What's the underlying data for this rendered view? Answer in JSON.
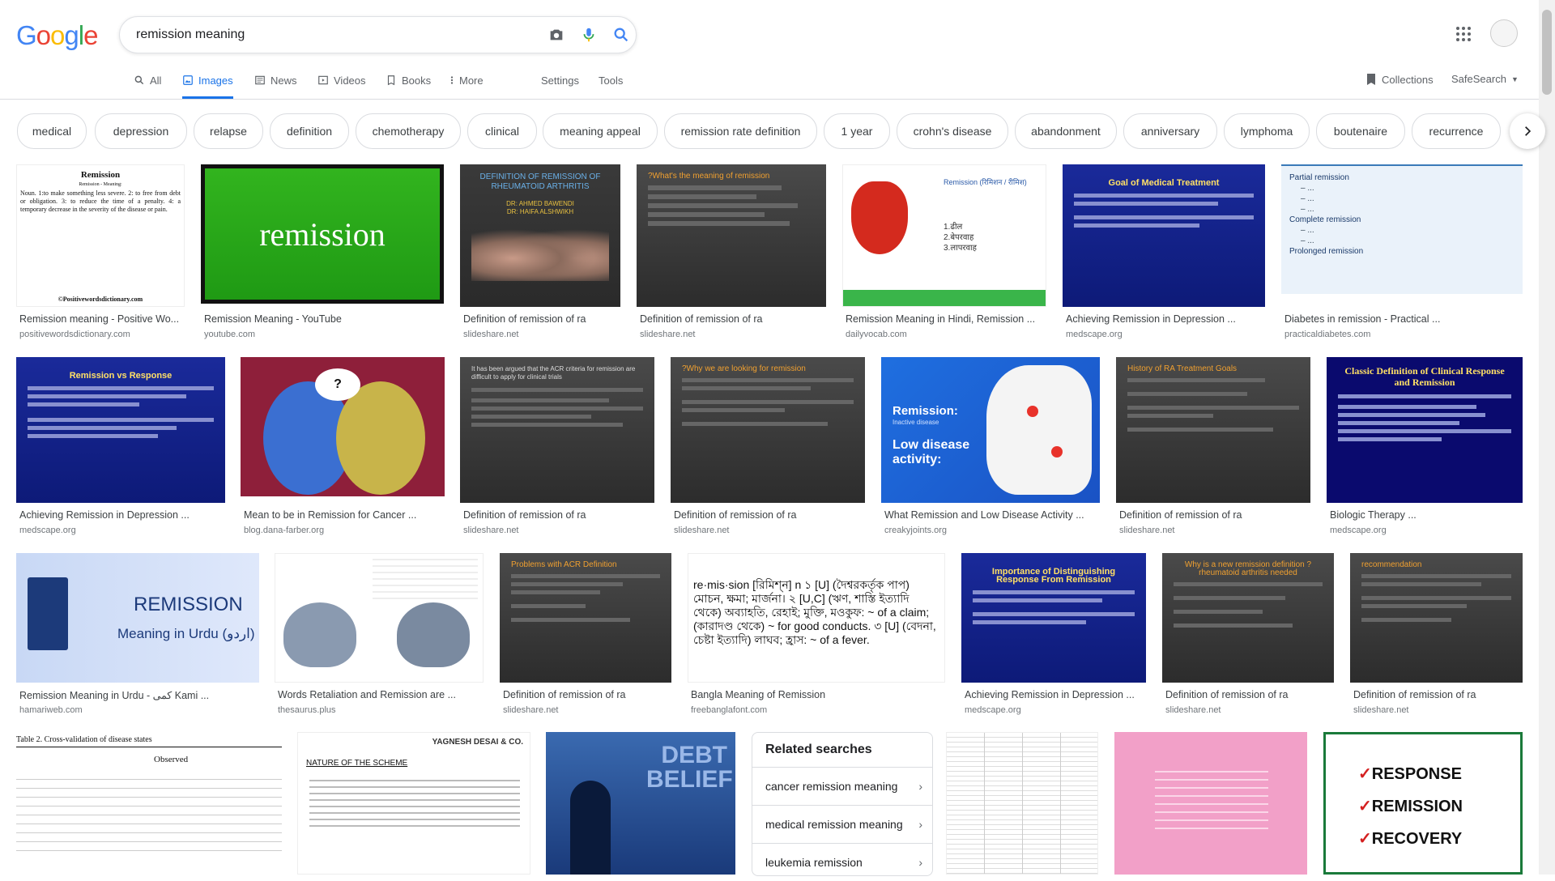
{
  "search": {
    "query": "remission meaning"
  },
  "logo": {
    "letters": [
      "G",
      "o",
      "o",
      "g",
      "l",
      "e"
    ],
    "colors": [
      "#4285f4",
      "#ea4335",
      "#fbbc05",
      "#4285f4",
      "#34a853",
      "#ea4335"
    ]
  },
  "tabs": [
    {
      "label": "All",
      "icon": "search-icon"
    },
    {
      "label": "Images",
      "icon": "image-icon",
      "active": true
    },
    {
      "label": "News",
      "icon": "news-icon"
    },
    {
      "label": "Videos",
      "icon": "video-icon"
    },
    {
      "label": "Books",
      "icon": "book-icon"
    },
    {
      "label": "More",
      "icon": "more-vert-icon"
    }
  ],
  "tools": {
    "settings": "Settings",
    "tools": "Tools",
    "collections": "Collections",
    "safesearch": "SafeSearch"
  },
  "chips": [
    "medical",
    "depression",
    "relapse",
    "definition",
    "chemotherapy",
    "clinical",
    "meaning appeal",
    "remission rate definition",
    "1 year",
    "crohn's disease",
    "abandonment",
    "anniversary",
    "lymphoma",
    "boutenaire",
    "recurrence"
  ],
  "results": [
    {
      "caption": "Remission meaning - Positive Wo...",
      "source": "positivewordsdictionary.com"
    },
    {
      "caption": "Remission Meaning - YouTube",
      "source": "youtube.com"
    },
    {
      "caption": "Definition of remission of ra",
      "source": "slideshare.net"
    },
    {
      "caption": "Definition of remission of ra",
      "source": "slideshare.net"
    },
    {
      "caption": "Remission Meaning in Hindi, Remission ...",
      "source": "dailyvocab.com"
    },
    {
      "caption": "Achieving Remission in Depression ...",
      "source": "medscape.org"
    },
    {
      "caption": "Diabetes in remission - Practical ...",
      "source": "practicaldiabetes.com"
    },
    {
      "caption": "Achieving Remission in Depression ...",
      "source": "medscape.org"
    },
    {
      "caption": "Mean to be in Remission for Cancer ...",
      "source": "blog.dana-farber.org"
    },
    {
      "caption": "Definition of remission of ra",
      "source": "slideshare.net"
    },
    {
      "caption": "Definition of remission of ra",
      "source": "slideshare.net"
    },
    {
      "caption": "What Remission and Low Disease Activity ...",
      "source": "creakyjoints.org"
    },
    {
      "caption": "Definition of remission of ra",
      "source": "slideshare.net"
    },
    {
      "caption": "Biologic Therapy ...",
      "source": "medscape.org"
    },
    {
      "caption": "Remission Meaning in Urdu - کمی Kami ...",
      "source": "hamariweb.com"
    },
    {
      "caption": "Words Retaliation and Remission are ...",
      "source": "thesaurus.plus"
    },
    {
      "caption": "Definition of remission of ra",
      "source": "slideshare.net"
    },
    {
      "caption": "Bangla Meaning of Remission",
      "source": "freebanglafont.com"
    },
    {
      "caption": "Achieving Remission in Depression ...",
      "source": "medscape.org"
    },
    {
      "caption": "Definition of remission of ra",
      "source": "slideshare.net"
    },
    {
      "caption": "Definition of remission of ra",
      "source": "slideshare.net"
    }
  ],
  "thumb_text": {
    "r1": {
      "title": "Remission",
      "sub": "Remission - Meaning:",
      "body": "Noun. 1:to make something less severe. 2: to free from debt or obligation. 3: to reduce the time of a penalty. 4: a temporary decrease in the severity of the disease or pain.",
      "foot": "©Positivewordsdictionary.com"
    },
    "r2": {
      "word": "remission"
    },
    "r3": {
      "title": "DEFINITION OF REMISSION OF RHEUMATOID ARTHRITIS",
      "a1": "DR: AHMED  BAWENDI",
      "a2": "DR: HAIFA  ALSHWIKH"
    },
    "r4": {
      "title": "?What's the meaning of remission"
    },
    "r5": {
      "title": "Remission (रिमिशन / रीमिश)",
      "l1": "1.ढील",
      "l2": "2.बेपरवाह",
      "l3": "3.लापरवाह"
    },
    "r6": {
      "title": "Goal of Medical Treatment"
    },
    "r7": {
      "l1": "Partial remission",
      "l2": "Complete remission",
      "l3": "Prolonged remission"
    },
    "r8": {
      "title": "Remission vs Response"
    },
    "r10": {
      "body": "It has been argued that the ACR criteria for remission are difficult to apply for clinical trials"
    },
    "r11": {
      "title": "?Why we are looking for remission"
    },
    "r12": {
      "t1": "Remission:",
      "t2": "Inactive disease",
      "t3": "Low disease activity:"
    },
    "r13": {
      "title": "History of  RA Treatment Goals"
    },
    "r14": {
      "title": "Classic Definition of Clinical Response and Remission"
    },
    "r15": {
      "word": "REMISSION",
      "sub": "Meaning in Urdu (اردو)"
    },
    "r17": {
      "title": "Problems with ACR Definition"
    },
    "r18": {
      "head": "re·mis·sion [রিমিশ্‌ন] n ১ [U] (দৈশ্বরকর্তৃক পাপ) মোচন, ক্ষমা; মার্জনা। ২ [U,C] (ঋণ, শাস্তি ইত্যাদি থেকে) অব্যাহতি, রেহাই; মুক্তি, মওকুফ: ~ of a claim; (কারাদণ্ড থেকে) ~ for good conducts. ৩ [U] (বেদনা, চেষ্টা ইত্যাদি) লাঘব; হ্রাস: ~ of a fever."
    },
    "r19": {
      "title": "Importance of Distinguishing Response From Remission"
    },
    "r20": {
      "title": "Why is a new remission definition ?rheumatoid arthritis needed"
    },
    "r21": {
      "title": "recommendation"
    },
    "b1": {
      "title": "Table 2.  Cross-validation of disease states",
      "head": "Observed"
    },
    "b2": {
      "brand": "YAGNESH DESAI & CO.",
      "title": "NATURE OF THE SCHEME"
    },
    "b3": {
      "word": "DEBT BELIEF"
    },
    "b6": {
      "w1": "RESPONSE",
      "w2": "REMISSION",
      "w3": "RECOVERY"
    }
  },
  "related": {
    "title": "Related searches",
    "items": [
      "cancer remission meaning",
      "medical remission meaning",
      "leukemia remission"
    ]
  }
}
